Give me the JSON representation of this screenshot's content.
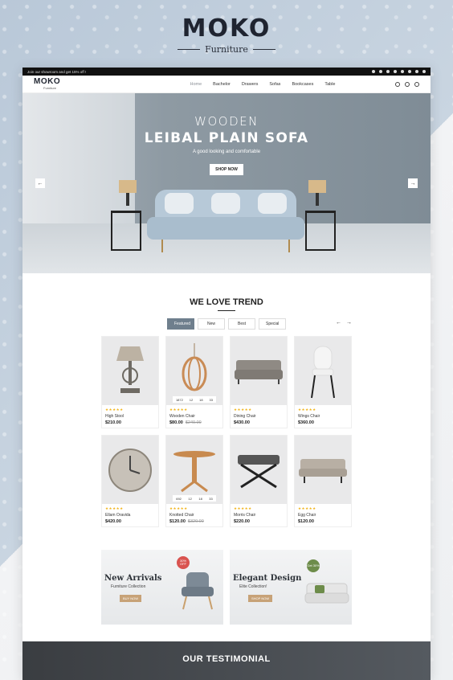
{
  "brand": {
    "logo": "MOKO",
    "subtitle": "Furniture"
  },
  "site": {
    "topbar": {
      "promo": "Join our showroom and get 15% off !"
    },
    "header": {
      "logo_name": "MOKO",
      "logo_sub": "Furniture",
      "menu": [
        "Home",
        "Bachelor",
        "Drawers",
        "Sofas",
        "Bookcases",
        "Table"
      ]
    },
    "hero": {
      "small": "WOODEN",
      "big": "LEIBAL PLAIN SOFA",
      "tagline": "A good looking and comfortable",
      "button": "SHOP NOW",
      "prev": "←",
      "next": "→"
    },
    "trend": {
      "title": "WE LOVE TREND",
      "tabs": [
        "Featured",
        "New",
        "Best",
        "Special"
      ],
      "prev": "←",
      "next": "→"
    },
    "products": [
      {
        "name": "High Stool",
        "price": "$210.00",
        "old": ""
      },
      {
        "name": "Wooden Chair",
        "price": "$80.00",
        "old": "$240.00",
        "timer": [
          "1872",
          "12",
          "18",
          "33"
        ]
      },
      {
        "name": "Dining Chair",
        "price": "$430.00",
        "old": ""
      },
      {
        "name": "Wings Chair",
        "price": "$360.00",
        "old": ""
      },
      {
        "name": "Ellam Oravida",
        "price": "$420.00",
        "old": ""
      },
      {
        "name": "Knotted Chair",
        "price": "$120.00",
        "old": "$320.00",
        "timer": [
          "692",
          "12",
          "18",
          "33"
        ]
      },
      {
        "name": "Morris Chair",
        "price": "$220.00",
        "old": ""
      },
      {
        "name": "Egg Chair",
        "price": "$120.00",
        "old": ""
      }
    ],
    "stars": "★★★★★",
    "banners": [
      {
        "title": "New Arrivals",
        "subtitle": "Furniture Collection",
        "button": "BUY NOW",
        "badge": "30% OFF"
      },
      {
        "title": "Elegant Design",
        "subtitle": "Elite Collection!",
        "button": "SHOP NOW",
        "badge": "Get 30%"
      }
    ],
    "testimonial": {
      "title": "OUR TESTIMONIAL"
    }
  }
}
